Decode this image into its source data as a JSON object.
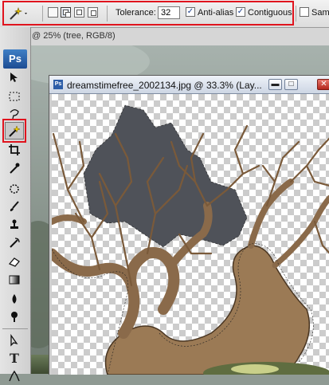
{
  "options_bar": {
    "tolerance_label": "Tolerance:",
    "tolerance_value": "32",
    "anti_alias_label": "Anti-alias",
    "anti_alias_checked": true,
    "contiguous_label": "Contiguous",
    "contiguous_checked": true,
    "sample_all_label": "Sampl",
    "sample_all_checked": false,
    "tool_icon": "magic-wand-icon",
    "selection_modes": [
      "new-selection",
      "add-to-selection",
      "subtract-from-selection",
      "intersect-selection"
    ],
    "active_mode": "add-to-selection"
  },
  "doc_strip": {
    "label": "@ 25% (tree, RGB/8)"
  },
  "toolbox": {
    "logo": "Ps",
    "tools": [
      "move-icon",
      "marquee-icon",
      "lasso-icon",
      "magic-wand-icon",
      "crop-icon",
      "eyedropper-icon",
      "healing-icon",
      "brush-icon",
      "clone-stamp-icon",
      "history-brush-icon",
      "eraser-icon",
      "gradient-icon",
      "blur-icon",
      "dodge-icon",
      "path-select-icon",
      "type-icon",
      "pen-icon"
    ],
    "selected_tool": "magic-wand-icon"
  },
  "document": {
    "title": "dreamstimefree_2002134.jpg @ 33.3% (Lay...",
    "minimize_label": "▬",
    "maximize_label": "□",
    "close_label": "✕"
  },
  "colors": {
    "highlight": "#e0141e",
    "selection_fill": "#4f5259",
    "bark": "#8a6a4a"
  }
}
